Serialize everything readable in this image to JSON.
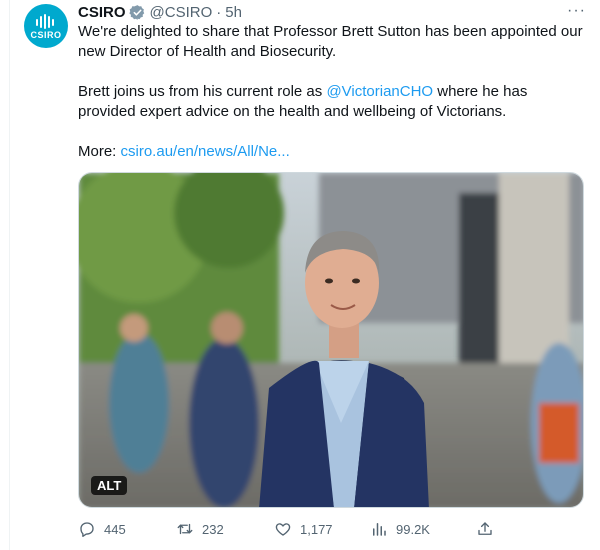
{
  "tweet": {
    "author": {
      "display_name": "CSIRO",
      "handle": "@CSIRO",
      "avatar_text": "CSIRO",
      "verified": true
    },
    "separator": "·",
    "time": "5h",
    "more_glyph": "···",
    "paragraphs": {
      "p1": "We're delighted to share that Professor Brett Sutton has been appointed our new Director of Health and Biosecurity.",
      "p2_before": "Brett joins us from his current role as ",
      "p2_mention": "@VictorianCHO",
      "p2_after": " where he has provided expert advice on the health and wellbeing of Victorians.",
      "p3_label": "More: ",
      "p3_link": "csiro.au/en/news/All/Ne..."
    },
    "media": {
      "alt_badge": "ALT"
    },
    "actions": {
      "replies": "445",
      "reposts": "232",
      "likes": "1,177",
      "views": "99.2K"
    }
  },
  "colors": {
    "accent": "#1d9bf0",
    "avatar_bg": "#00a9ce",
    "muted": "#536471",
    "text": "#0f1419"
  }
}
